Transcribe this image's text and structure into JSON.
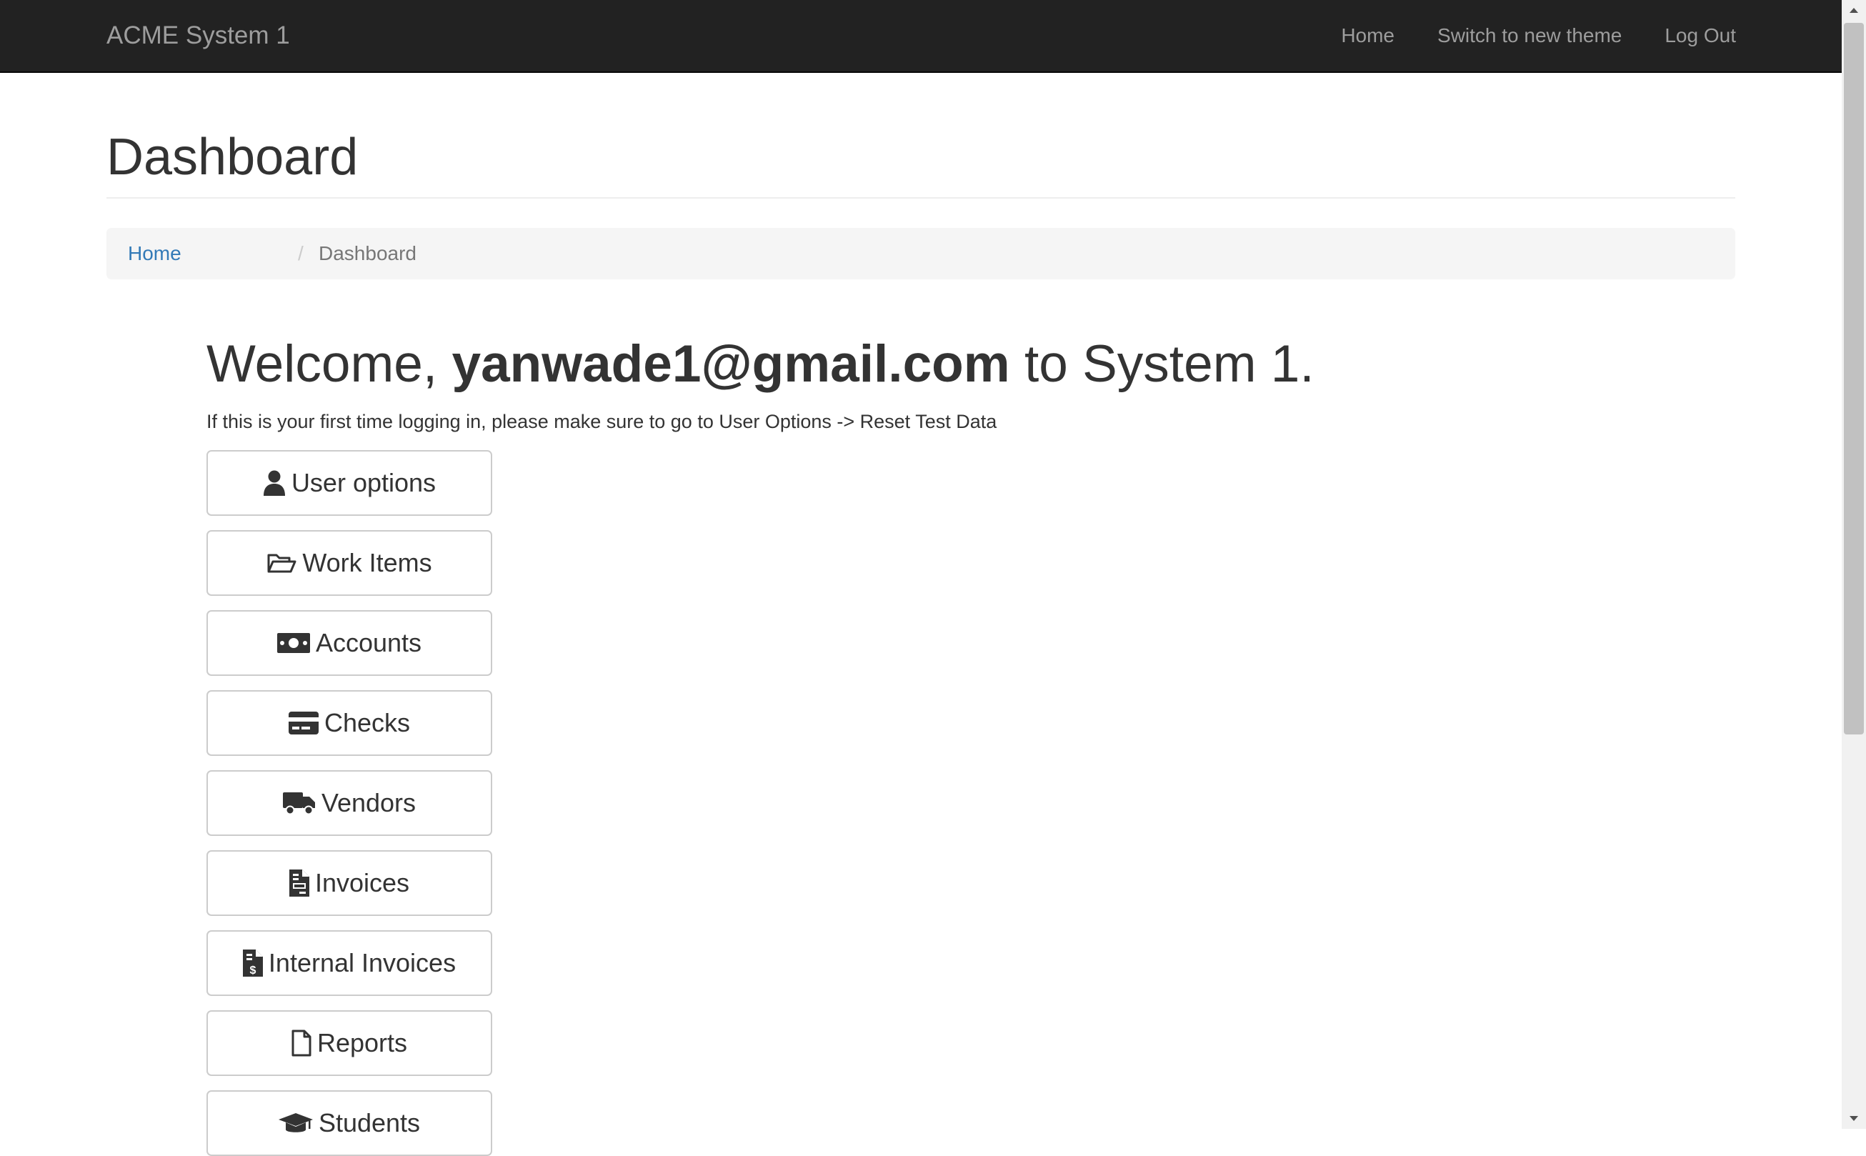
{
  "navbar": {
    "brand": "ACME System 1",
    "links": [
      "Home",
      "Switch to new theme",
      "Log Out"
    ]
  },
  "page": {
    "title": "Dashboard"
  },
  "breadcrumb": {
    "home": "Home",
    "separator": "/",
    "current": "Dashboard"
  },
  "welcome": {
    "prefix": "Welcome, ",
    "email": "yanwade1@gmail.com",
    "suffix": " to System 1.",
    "hint": "If this is your first time logging in, please make sure to go to User Options -> Reset Test Data"
  },
  "menu": [
    {
      "label": "User options",
      "icon": "user-icon"
    },
    {
      "label": "Work Items",
      "icon": "folder-open-icon"
    },
    {
      "label": "Accounts",
      "icon": "money-bill-icon"
    },
    {
      "label": "Checks",
      "icon": "credit-card-icon"
    },
    {
      "label": "Vendors",
      "icon": "truck-icon"
    },
    {
      "label": "Invoices",
      "icon": "file-invoice-icon"
    },
    {
      "label": "Internal Invoices",
      "icon": "file-invoice-dollar-icon"
    },
    {
      "label": "Reports",
      "icon": "file-icon"
    },
    {
      "label": "Students",
      "icon": "graduation-cap-icon"
    }
  ],
  "colors": {
    "navbar_bg": "#222222",
    "navbar_text": "#9d9d9d",
    "link": "#337ab7",
    "text": "#333333",
    "breadcrumb_bg": "#f5f5f5"
  }
}
